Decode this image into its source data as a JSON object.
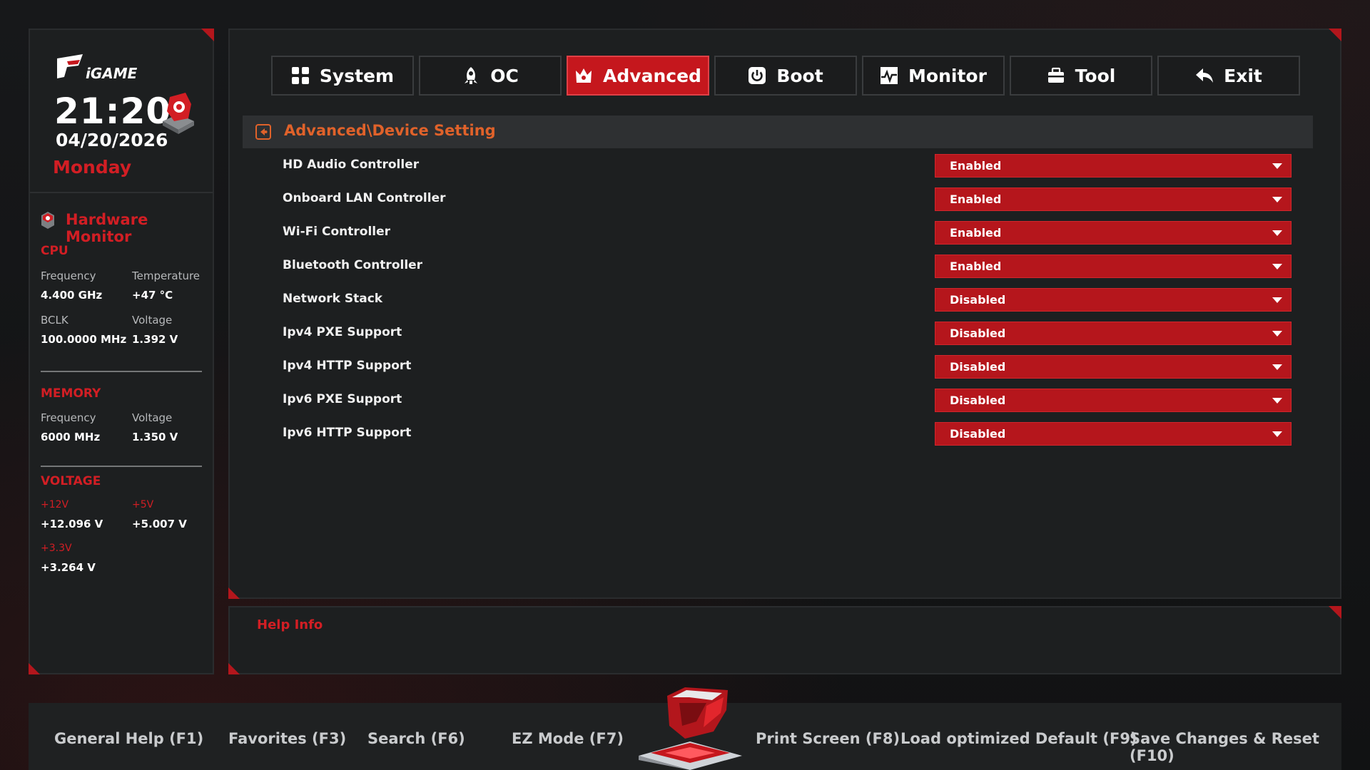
{
  "clock": {
    "time": "21:20",
    "date": "04/20/2026",
    "weekday": "Monday"
  },
  "hardware_monitor": {
    "title": "Hardware Monitor",
    "cpu": {
      "title": "CPU",
      "frequency_label": "Frequency",
      "frequency_value": "4.400 GHz",
      "temperature_label": "Temperature",
      "temperature_value": "+47 °C",
      "bclk_label": "BCLK",
      "bclk_value": "100.0000 MHz",
      "voltage_label": "Voltage",
      "voltage_value": "1.392 V"
    },
    "memory": {
      "title": "MEMORY",
      "frequency_label": "Frequency",
      "frequency_value": "6000 MHz",
      "voltage_label": "Voltage",
      "voltage_value": "1.350 V"
    },
    "voltage": {
      "title": "VOLTAGE",
      "v12_label": "+12V",
      "v12_value": "+12.096 V",
      "v5_label": "+5V",
      "v5_value": "+5.007 V",
      "v33_label": "+3.3V",
      "v33_value": "+3.264 V"
    }
  },
  "tabs": [
    {
      "label": "System",
      "icon": "grid-icon",
      "active": false
    },
    {
      "label": "OC",
      "icon": "rocket-icon",
      "active": false
    },
    {
      "label": "Advanced",
      "icon": "crown-icon",
      "active": true
    },
    {
      "label": "Boot",
      "icon": "power-icon",
      "active": false
    },
    {
      "label": "Monitor",
      "icon": "pulse-icon",
      "active": false
    },
    {
      "label": "Tool",
      "icon": "toolbox-icon",
      "active": false
    },
    {
      "label": "Exit",
      "icon": "reply-icon",
      "active": false
    }
  ],
  "breadcrumb": "Advanced\\Device Setting",
  "settings": [
    {
      "label": "HD Audio Controller",
      "value": "Enabled"
    },
    {
      "label": "Onboard LAN Controller",
      "value": "Enabled"
    },
    {
      "label": "Wi-Fi Controller",
      "value": "Enabled"
    },
    {
      "label": "Bluetooth Controller",
      "value": "Enabled"
    },
    {
      "label": "Network Stack",
      "value": "Disabled"
    },
    {
      "label": "Ipv4 PXE Support",
      "value": "Disabled"
    },
    {
      "label": "Ipv4 HTTP Support",
      "value": "Disabled"
    },
    {
      "label": "Ipv6 PXE Support",
      "value": "Disabled"
    },
    {
      "label": "Ipv6 HTTP Support",
      "value": "Disabled"
    }
  ],
  "help": {
    "title": "Help Info"
  },
  "footer": {
    "general_help": "General Help (F1)",
    "favorites": "Favorites (F3)",
    "search": "Search (F6)",
    "ez_mode": "EZ Mode (F7)",
    "print_screen": "Print Screen (F8)",
    "load_default": "Load optimized Default (F9)",
    "save_reset": "Save Changes & Reset (F10)"
  },
  "colors": {
    "accent": "#c5171d",
    "breadcrumb": "#e0622a",
    "panel": "#1d1f20"
  }
}
